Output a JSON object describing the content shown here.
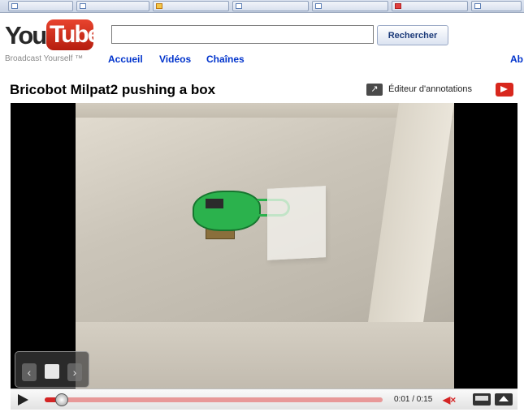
{
  "header": {
    "logo_you": "You",
    "logo_tube": "Tube",
    "tagline": "Broadcast Yourself ™",
    "search": {
      "value": "",
      "placeholder": "",
      "button_label": "Rechercher"
    },
    "nav": [
      "Accueil",
      "Vidéos",
      "Chaînes",
      "Ab"
    ]
  },
  "video": {
    "title": "Bricobot Milpat2 pushing a box",
    "annotations_editor_label": "Éditeur d'annotations",
    "annotations_icon": "arrow-up-right-icon",
    "annotations_toggle_icon": "annotations-toggle-icon"
  },
  "player": {
    "time_label": "0:01 / 0:15",
    "progress_played": 0.05,
    "progress_buffered": 1.0,
    "muted": true,
    "accent_color": "#d42424"
  },
  "overlay_nav": {
    "prev_icon": "chevron-left-icon",
    "center_icon": "page-add-icon",
    "next_icon": "chevron-right-icon"
  }
}
